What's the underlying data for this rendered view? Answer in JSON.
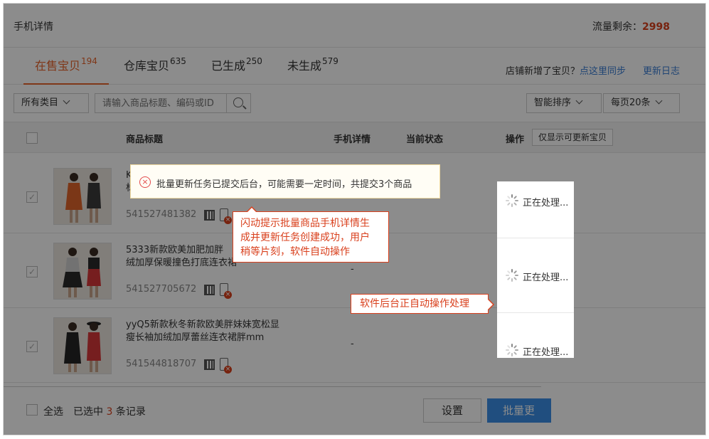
{
  "header": {
    "title": "手机详情",
    "traffic_label": "流量剩余：",
    "traffic_value": "2998"
  },
  "tabs": [
    {
      "label": "在售宝贝",
      "count": "194",
      "active": true
    },
    {
      "label": "仓库宝贝",
      "count": "635",
      "active": false
    },
    {
      "label": "已生成",
      "count": "250",
      "active": false
    },
    {
      "label": "未生成",
      "count": "579",
      "active": false
    }
  ],
  "sync": {
    "text": "店铺新增了宝贝？",
    "link": "点这里同步",
    "log_link": "更新日志"
  },
  "filter": {
    "category": "所有类目",
    "search_placeholder": "请输入商品标题、编码或ID",
    "sort": "智能排序",
    "page_size": "每页20条"
  },
  "table": {
    "headers": {
      "title": "商品标题",
      "detail": "手机详情",
      "status": "当前状态",
      "op": "操作",
      "only_btn": "仅显示可更新宝贝"
    },
    "rows": [
      {
        "title": "K",
        "title_line2": "标",
        "id": "541527481382",
        "detail": "",
        "status": "正在处理..."
      },
      {
        "title": "5333新款欧美加肥加胖",
        "title_line2": "绒加厚保暖撞色打底连衣裙",
        "id": "541527705672",
        "detail": "-",
        "status": "正在处理..."
      },
      {
        "title": "yyQ5新款秋冬新款欧美胖妹妹宽松显",
        "title_line2": "瘦长袖加绒加厚蕾丝连衣裙胖mm",
        "id": "541544818707",
        "detail": "-",
        "status": "正在处理..."
      }
    ]
  },
  "footer": {
    "select_all": "全选",
    "selected_prefix": "已选中",
    "selected_count": "3",
    "selected_suffix": "条记录",
    "set_btn": "设置",
    "batch_btn": "批量更"
  },
  "toast": {
    "message": "批量更新任务已提交后台，可能需要一定时间，共提交3个商品"
  },
  "callouts": {
    "c1_line1": "闪动提示批量商品手机详情生",
    "c1_line2": "成并更新任务创建成功，用户",
    "c1_line3": "稍等片刻，软件自动操作",
    "c2": "软件后台正自动操作处理"
  },
  "colors": {
    "accent": "#e8642c",
    "link": "#3b7ed4",
    "danger": "#d9401d",
    "primary_btn": "#3b8fe8"
  }
}
